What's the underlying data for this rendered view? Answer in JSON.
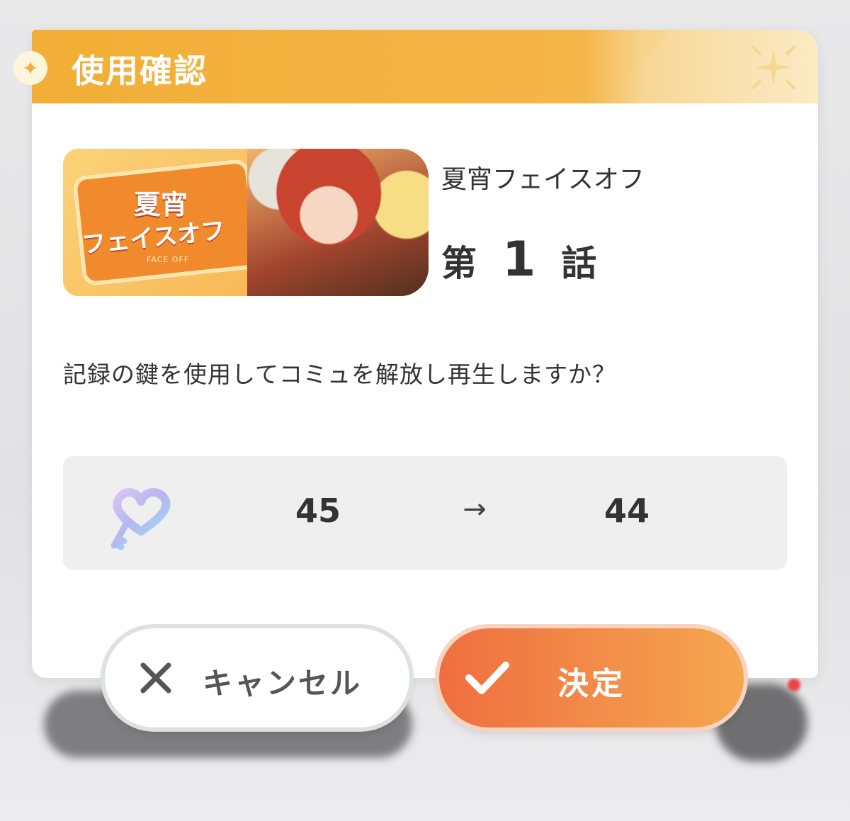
{
  "dialog": {
    "title": "使用確認"
  },
  "episode": {
    "banner_logo_top": "夏宵",
    "banner_logo_main": "フェイスオフ",
    "banner_logo_sub": "FACE OFF",
    "title": "夏宵フェイスオフ",
    "prefix": "第",
    "number": "1",
    "suffix": "話"
  },
  "question": "記録の鍵を使用してコミュを解放し再生しますか？",
  "cost": {
    "icon": "heart-key-icon",
    "before": "45",
    "arrow": "→",
    "after": "44"
  },
  "buttons": {
    "cancel_label": "キャンセル",
    "cancel_icon": "close-icon",
    "confirm_label": "決定",
    "confirm_icon": "check-icon"
  },
  "colors": {
    "header": "#f2ae36",
    "confirm": "#ef6e3f",
    "panel": "#efefef"
  }
}
